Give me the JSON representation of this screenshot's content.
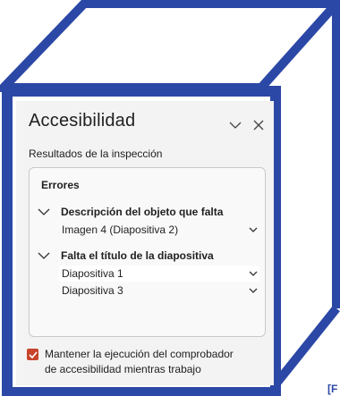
{
  "colors": {
    "frame": "#2c48a6",
    "panel_bg": "#f3f3f3",
    "checkbox_accent": "#c7442b"
  },
  "pane": {
    "title": "Accesibilidad",
    "collapse_icon": "chevron-down-icon",
    "close_icon": "close-icon",
    "subtitle": "Resultados de la inspección"
  },
  "results": {
    "section_label": "Errores",
    "groups": [
      {
        "label": "Descripción del objeto que falta",
        "expanded": true,
        "items": [
          {
            "label": "Imagen 4  (Diapositiva 2)",
            "selected": false
          }
        ]
      },
      {
        "label": "Falta el título de la diapositiva",
        "expanded": true,
        "items": [
          {
            "label": "Diapositiva 1",
            "selected": true
          },
          {
            "label": "Diapositiva 3",
            "selected": false
          }
        ]
      }
    ]
  },
  "footer": {
    "checkbox_checked": true,
    "label_line1": "Mantener la ejecución del comprobador",
    "label_line2": "de accesibilidad mientras trabajo"
  },
  "corner_mark": "[F"
}
